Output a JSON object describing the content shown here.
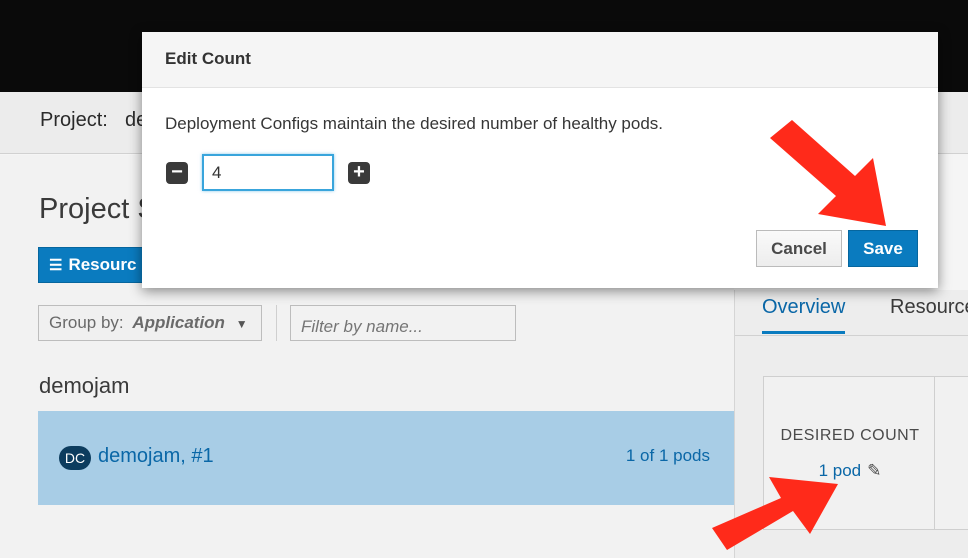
{
  "project_bar": {
    "label": "Project:",
    "name": "de"
  },
  "page": {
    "title": "Project S",
    "resources_button": "Resourc"
  },
  "toolbar": {
    "group_by_label": "Group by:",
    "group_by_value": "Application",
    "filter_placeholder": "Filter by name..."
  },
  "application": {
    "name": "demojam",
    "deployment": {
      "badge": "DC",
      "name": "demojam",
      "revision": ", #1",
      "pods": "1 of 1 pods"
    }
  },
  "side_panel": {
    "tabs": [
      "Overview",
      "Resource"
    ],
    "desired_count_label": "DESIRED COUNT",
    "desired_count_value": "1 pod"
  },
  "modal": {
    "title": "Edit Count",
    "description": "Deployment Configs maintain the desired number of healthy pods.",
    "count_value": "4",
    "cancel_label": "Cancel",
    "save_label": "Save"
  },
  "colors": {
    "accent": "#0a7bbf",
    "annotation_arrow": "#ff2a1a"
  },
  "icons": [
    "list-icon",
    "chevron-down-icon",
    "minus-icon",
    "plus-icon",
    "pencil-icon",
    "annotation-arrow-icon"
  ]
}
